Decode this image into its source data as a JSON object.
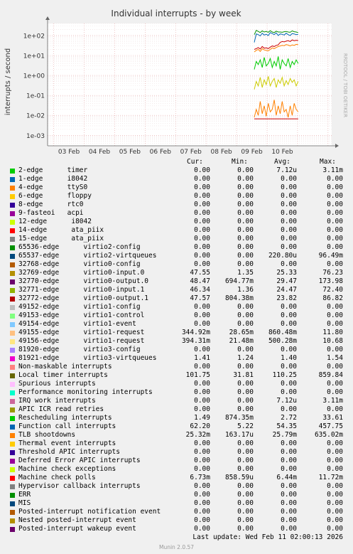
{
  "chart_data": {
    "type": "line",
    "title": "Individual interrupts - by week",
    "ylabel": "interrupts / second",
    "watermark": "RRDTOOL / TOBI OETIKER",
    "yscale": "log",
    "ylim": [
      0.0003,
      400
    ],
    "yticks": [
      {
        "value": 100,
        "label": "1e+02"
      },
      {
        "value": 10,
        "label": "1e+01"
      },
      {
        "value": 1,
        "label": "1e+00"
      },
      {
        "value": 0.1,
        "label": "1e-01"
      },
      {
        "value": 0.01,
        "label": "1e-02"
      },
      {
        "value": 0.001,
        "label": "1e-03"
      }
    ],
    "xlim": [
      -0.7,
      8.62
    ],
    "xticks": [
      {
        "value": 0,
        "label": "03 Feb"
      },
      {
        "value": 1,
        "label": "04 Feb"
      },
      {
        "value": 2,
        "label": "05 Feb"
      },
      {
        "value": 3,
        "label": "06 Feb"
      },
      {
        "value": 4,
        "label": "07 Feb"
      },
      {
        "value": 5,
        "label": "08 Feb"
      },
      {
        "value": 6,
        "label": "09 Feb"
      },
      {
        "value": 7,
        "label": "10 Feb"
      }
    ],
    "data_start": 6.08,
    "data_end": 7.52,
    "series": [
      {
        "name": "Function call interrupts",
        "color": "#0066B3",
        "values": [
          45,
          120,
          110,
          95,
          130,
          105,
          115,
          100,
          140,
          125,
          110,
          135,
          100,
          120,
          115,
          105,
          130,
          110,
          100,
          125,
          120,
          110,
          115
        ]
      },
      {
        "name": "Local timer interrupts",
        "color": "#008F00",
        "values": [
          110,
          180,
          160,
          140,
          170,
          150,
          160,
          145,
          175,
          150,
          140,
          165,
          150,
          150,
          145,
          155,
          160,
          150,
          145,
          170,
          155,
          150,
          140
        ]
      },
      {
        "name": "virtio0-input.0",
        "color": "#CC0000",
        "values": [
          20,
          22,
          25,
          21,
          28,
          23,
          24,
          22,
          26,
          30,
          28,
          32,
          34,
          45,
          50,
          48,
          52,
          55,
          50,
          60,
          55,
          58,
          56
        ]
      },
      {
        "name": "virtio0-output.0",
        "color": "#FF8000",
        "values": [
          15,
          18,
          20,
          16,
          22,
          19,
          18,
          17,
          20,
          24,
          22,
          25,
          28,
          30,
          32,
          31,
          35,
          33,
          30,
          34,
          32,
          36,
          35
        ]
      },
      {
        "name": "Rescheduling interrupts",
        "color": "#00CC00",
        "values": [
          2.0,
          5.0,
          3.5,
          6.0,
          2.5,
          8.0,
          3.0,
          4.0,
          7.0,
          2.5,
          5.0,
          3.0,
          9.0,
          2.0,
          6.0,
          4.0,
          3.0,
          7.0,
          2.5,
          5.0,
          3.5,
          6.0,
          4.0
        ]
      },
      {
        "name": "virtio0-input.1",
        "color": "#CCCC00",
        "values": [
          0.2,
          0.5,
          0.3,
          0.8,
          0.25,
          0.6,
          0.35,
          0.9,
          0.3,
          0.5,
          0.7,
          0.25,
          0.6,
          0.4,
          0.8,
          0.3,
          0.55,
          0.35,
          0.7,
          0.45,
          0.6,
          0.3,
          0.5
        ]
      },
      {
        "name": "TLB shootdowns",
        "color": "#FF8000",
        "values": [
          0.008,
          0.02,
          0.01,
          0.05,
          0.012,
          0.03,
          0.009,
          0.04,
          0.015,
          0.02,
          0.06,
          0.01,
          0.03,
          0.012,
          0.05,
          0.015,
          0.02,
          0.008,
          0.03,
          0.01,
          0.04,
          0.02,
          0.015
        ]
      },
      {
        "name": "Machine check polls",
        "color": "#CC0000",
        "values": [
          0.0067,
          0.0067,
          0.0067,
          0.0067,
          0.0067,
          0.0067,
          0.0067,
          0.0067,
          0.0067,
          0.0067,
          0.0067,
          0.0067,
          0.0067,
          0.0067,
          0.0067,
          0.0067,
          0.0067,
          0.0067,
          0.0067,
          0.0067,
          0.0067,
          0.0067,
          0.0067
        ]
      }
    ]
  },
  "legend": {
    "headers": {
      "cur": "Cur:",
      "min": "Min:",
      "avg": "Avg:",
      "max": "Max:"
    },
    "rows": [
      {
        "label": "2-edge      timer",
        "color": "#00CC00",
        "cur": "0.00",
        "min": "0.00",
        "avg": "7.12u",
        "max": "3.11m"
      },
      {
        "label": "1-edge      i8042",
        "color": "#0066B3",
        "cur": "0.00",
        "min": "0.00",
        "avg": "0.00",
        "max": "0.00"
      },
      {
        "label": "4-edge      ttyS0",
        "color": "#FF8000",
        "cur": "0.00",
        "min": "0.00",
        "avg": "0.00",
        "max": "0.00"
      },
      {
        "label": "6-edge      floppy",
        "color": "#FFCC00",
        "cur": "0.00",
        "min": "0.00",
        "avg": "0.00",
        "max": "0.00"
      },
      {
        "label": "8-edge      rtc0",
        "color": "#330099",
        "cur": "0.00",
        "min": "0.00",
        "avg": "0.00",
        "max": "0.00"
      },
      {
        "label": "9-fasteoi   acpi",
        "color": "#990099",
        "cur": "0.00",
        "min": "0.00",
        "avg": "0.00",
        "max": "0.00"
      },
      {
        "label": "12-edge      i8042",
        "color": "#CCFF00",
        "cur": "0.00",
        "min": "0.00",
        "avg": "0.00",
        "max": "0.00"
      },
      {
        "label": "14-edge      ata_piix",
        "color": "#FF0000",
        "cur": "0.00",
        "min": "0.00",
        "avg": "0.00",
        "max": "0.00"
      },
      {
        "label": "15-edge      ata_piix",
        "color": "#808080",
        "cur": "0.00",
        "min": "0.00",
        "avg": "0.00",
        "max": "0.00"
      },
      {
        "label": "65536-edge      virtio2-config",
        "color": "#008F00",
        "cur": "0.00",
        "min": "0.00",
        "avg": "0.00",
        "max": "0.00"
      },
      {
        "label": "65537-edge      virtio2-virtqueues",
        "color": "#00487D",
        "cur": "0.00",
        "min": "0.00",
        "avg": "220.80u",
        "max": "96.49m"
      },
      {
        "label": "32768-edge      virtio0-config",
        "color": "#B35A00",
        "cur": "0.00",
        "min": "0.00",
        "avg": "0.00",
        "max": "0.00"
      },
      {
        "label": "32769-edge      virtio0-input.0",
        "color": "#B38F00",
        "cur": "47.55",
        "min": "1.35",
        "avg": "25.33",
        "max": "76.23"
      },
      {
        "label": "32770-edge      virtio0-output.0",
        "color": "#6B006B",
        "cur": "48.47",
        "min": "694.77m",
        "avg": "29.47",
        "max": "173.98"
      },
      {
        "label": "32771-edge      virtio0-input.1",
        "color": "#8FB300",
        "cur": "46.34",
        "min": "1.36",
        "avg": "24.47",
        "max": "72.40"
      },
      {
        "label": "32772-edge      virtio0-output.1",
        "color": "#B30000",
        "cur": "47.57",
        "min": "804.38m",
        "avg": "23.82",
        "max": "86.82"
      },
      {
        "label": "49152-edge      virtio1-config",
        "color": "#BEBEBE",
        "cur": "0.00",
        "min": "0.00",
        "avg": "0.00",
        "max": "0.00"
      },
      {
        "label": "49153-edge      virtio1-control",
        "color": "#80FF80",
        "cur": "0.00",
        "min": "0.00",
        "avg": "0.00",
        "max": "0.00"
      },
      {
        "label": "49154-edge      virtio1-event",
        "color": "#80C9FF",
        "cur": "0.00",
        "min": "0.00",
        "avg": "0.00",
        "max": "0.00"
      },
      {
        "label": "49155-edge      virtio1-request",
        "color": "#FFC080",
        "cur": "344.92m",
        "min": "28.65m",
        "avg": "860.48m",
        "max": "11.80"
      },
      {
        "label": "49156-edge      virtio1-request",
        "color": "#FFE680",
        "cur": "394.31m",
        "min": "21.48m",
        "avg": "500.28m",
        "max": "10.68"
      },
      {
        "label": "81920-edge      virtio3-config",
        "color": "#AA80FF",
        "cur": "0.00",
        "min": "0.00",
        "avg": "0.00",
        "max": "0.00"
      },
      {
        "label": "81921-edge      virtio3-virtqueues",
        "color": "#EE00CC",
        "cur": "1.41",
        "min": "1.24",
        "avg": "1.40",
        "max": "1.54"
      },
      {
        "label": "Non-maskable interrupts",
        "color": "#FF8080",
        "cur": "0.00",
        "min": "0.00",
        "avg": "0.00",
        "max": "0.00"
      },
      {
        "label": "Local timer interrupts",
        "color": "#666600",
        "cur": "101.75",
        "min": "31.81",
        "avg": "110.25",
        "max": "859.84"
      },
      {
        "label": "Spurious interrupts",
        "color": "#FFBFFF",
        "cur": "0.00",
        "min": "0.00",
        "avg": "0.00",
        "max": "0.00"
      },
      {
        "label": "Performance monitoring interrupts",
        "color": "#00FFCC",
        "cur": "0.00",
        "min": "0.00",
        "avg": "0.00",
        "max": "0.00"
      },
      {
        "label": "IRQ work interrupts",
        "color": "#CC6699",
        "cur": "0.00",
        "min": "0.00",
        "avg": "7.12u",
        "max": "3.11m"
      },
      {
        "label": "APIC ICR read retries",
        "color": "#999900",
        "cur": "0.00",
        "min": "0.00",
        "avg": "0.00",
        "max": "0.00"
      },
      {
        "label": "Rescheduling interrupts",
        "color": "#00CC00",
        "cur": "1.49",
        "min": "874.35m",
        "avg": "2.72",
        "max": "33.61"
      },
      {
        "label": "Function call interrupts",
        "color": "#0066B3",
        "cur": "62.20",
        "min": "5.22",
        "avg": "54.35",
        "max": "457.75"
      },
      {
        "label": "TLB shootdowns",
        "color": "#FF8000",
        "cur": "25.32m",
        "min": "163.17u",
        "avg": "25.79m",
        "max": "635.02m"
      },
      {
        "label": "Thermal event interrupts",
        "color": "#FFCC00",
        "cur": "0.00",
        "min": "0.00",
        "avg": "0.00",
        "max": "0.00"
      },
      {
        "label": "Threshold APIC interrupts",
        "color": "#330099",
        "cur": "0.00",
        "min": "0.00",
        "avg": "0.00",
        "max": "0.00"
      },
      {
        "label": "Deferred Error APIC interrupts",
        "color": "#990099",
        "cur": "0.00",
        "min": "0.00",
        "avg": "0.00",
        "max": "0.00"
      },
      {
        "label": "Machine check exceptions",
        "color": "#CCFF00",
        "cur": "0.00",
        "min": "0.00",
        "avg": "0.00",
        "max": "0.00"
      },
      {
        "label": "Machine check polls",
        "color": "#FF0000",
        "cur": "6.73m",
        "min": "858.59u",
        "avg": "6.44m",
        "max": "11.72m"
      },
      {
        "label": "Hypervisor callback interrupts",
        "color": "#808080",
        "cur": "0.00",
        "min": "0.00",
        "avg": "0.00",
        "max": "0.00"
      },
      {
        "label": "ERR",
        "color": "#008F00",
        "cur": "0.00",
        "min": "0.00",
        "avg": "0.00",
        "max": "0.00"
      },
      {
        "label": "MIS",
        "color": "#00487D",
        "cur": "0.00",
        "min": "0.00",
        "avg": "0.00",
        "max": "0.00"
      },
      {
        "label": "Posted-interrupt notification event",
        "color": "#B35A00",
        "cur": "0.00",
        "min": "0.00",
        "avg": "0.00",
        "max": "0.00"
      },
      {
        "label": "Nested posted-interrupt event",
        "color": "#B38F00",
        "cur": "0.00",
        "min": "0.00",
        "avg": "0.00",
        "max": "0.00"
      },
      {
        "label": "Posted-interrupt wakeup event",
        "color": "#6B006B",
        "cur": "0.00",
        "min": "0.00",
        "avg": "0.00",
        "max": "0.00"
      }
    ]
  },
  "footer": {
    "last_update": "Last update: Wed Feb 11 02:00:13 2026",
    "munin": "Munin 2.0.57"
  }
}
